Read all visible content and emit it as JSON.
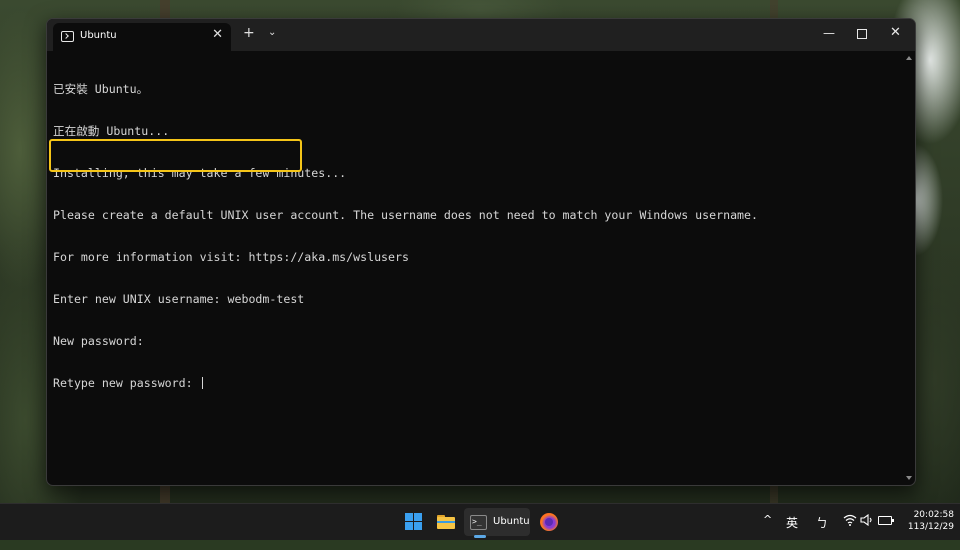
{
  "window": {
    "tab_title": "Ubuntu",
    "tab_close": "✕",
    "new_tab": "+",
    "tab_dropdown": "⌄",
    "minimize": "—",
    "maximize": "",
    "close": "✕"
  },
  "terminal": {
    "lines": [
      "已安裝 Ubuntu。",
      "正在啟動 Ubuntu...",
      "Installing, this may take a few minutes...",
      "Please create a default UNIX user account. The username does not need to match your Windows username.",
      "For more information visit: https://aka.ms/wslusers",
      "Enter new UNIX username: webodm-test",
      "New password:",
      "Retype new password: "
    ],
    "highlight_color": "#f5c518"
  },
  "taskbar": {
    "running_app_label": "Ubuntu",
    "tray_chevron": "^",
    "ime_mode": "英",
    "ime_phonetic": "ㄅ",
    "wifi_icon": "wifi-icon",
    "volume_icon": "volume-icon",
    "time": "20:02:58",
    "date": "113/12/29"
  },
  "colors": {
    "accent": "#3aa0f0",
    "terminal_bg": "#0c0c0c",
    "terminal_text": "#d6d6d6"
  }
}
